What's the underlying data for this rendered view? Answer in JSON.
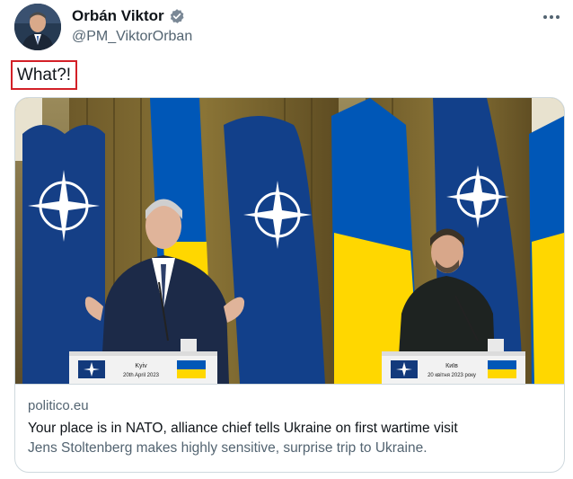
{
  "author": {
    "display_name": "Orbán Viktor",
    "handle": "@PM_ViktorOrban",
    "verified": true,
    "verified_icon": "verified-badge-icon"
  },
  "tweet": {
    "text": "What?!",
    "highlight_color": "#d32027"
  },
  "link_card": {
    "domain": "politico.eu",
    "headline": "Your place is in NATO, alliance chief tells Ukraine on first wartime visit",
    "description": "Jens Stoltenberg makes highly sensitive, surprise trip to Ukraine.",
    "image": {
      "left_sign": {
        "city": "Kyiv",
        "date": "20th April 2023"
      },
      "right_sign": {
        "city": "Київ",
        "date": "20 квітня 2023 року"
      }
    }
  },
  "colors": {
    "nato_blue": "#0b3c7d",
    "ukraine_blue": "#0057b7",
    "ukraine_yellow": "#ffd700",
    "secondary_text": "#536471",
    "verified_blue": "#1d9bf0"
  }
}
